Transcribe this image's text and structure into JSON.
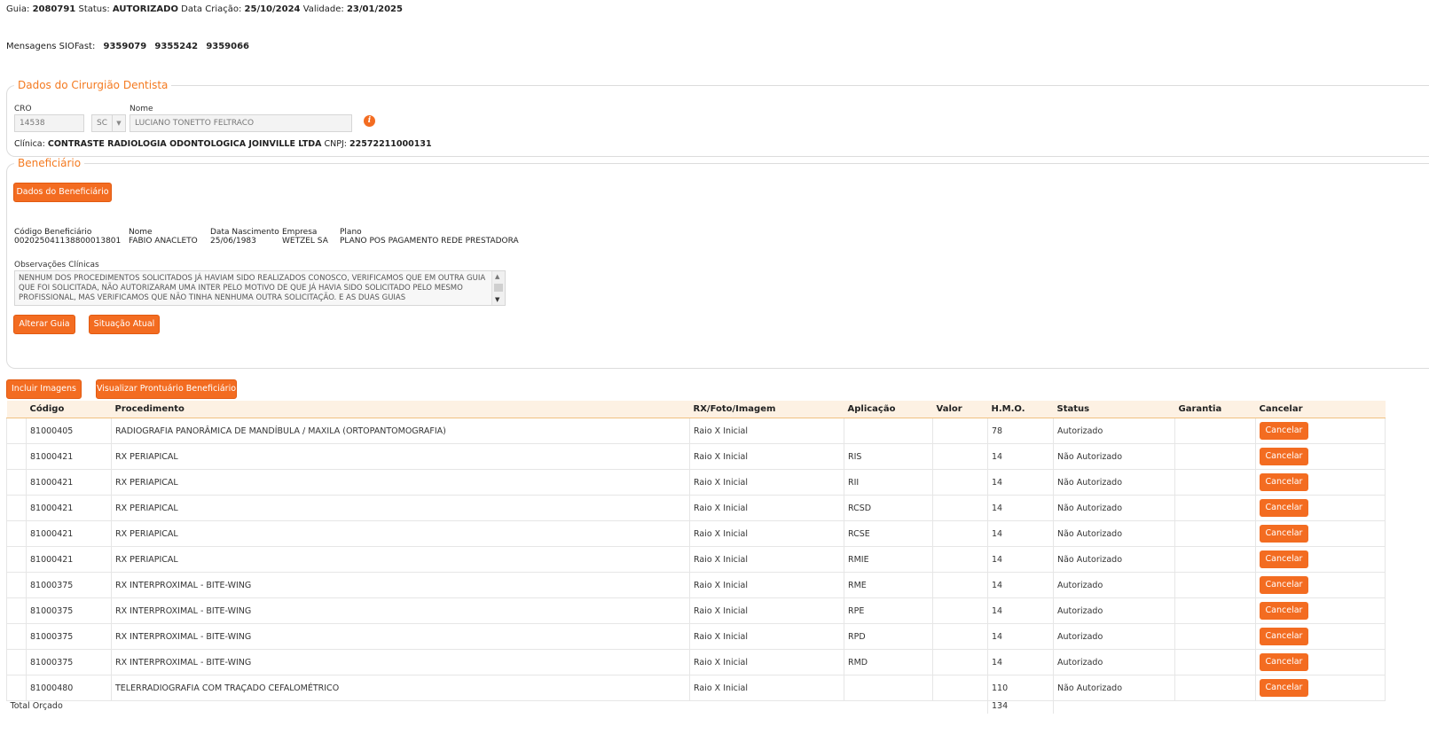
{
  "guia": {
    "guia_label": "Guia:",
    "guia_value": "2080791",
    "status_label": "Status:",
    "status_value": "AUTORIZADO",
    "criacao_label": "Data Criação:",
    "criacao_value": "25/10/2024",
    "validade_label": "Validade:",
    "validade_value": "23/01/2025"
  },
  "mensagens": {
    "label": "Mensagens SIOFast:",
    "values": [
      "9359079",
      "9355242",
      "9359066"
    ]
  },
  "dentista": {
    "legend": "Dados do Cirurgião Dentista",
    "cro_label": "CRO",
    "cro_value": "14538",
    "uf_value": "SC",
    "nome_label": "Nome",
    "nome_value": "LUCIANO TONETTO FELTRACO",
    "clinica_label": "Clínica:",
    "clinica_value": "CONTRASTE RADIOLOGIA ODONTOLOGICA JOINVILLE LTDA",
    "cnpj_label": "CNPJ:",
    "cnpj_value": "22572211000131"
  },
  "beneficiario": {
    "legend": "Beneficiário",
    "dados_button": "Dados do Beneficiário",
    "codigo_label": "Código Beneficiário",
    "codigo_value": "00202504113880001380​1",
    "nome_label": "Nome",
    "nome_value": "FABIO ANACLETO",
    "nasc_label": "Data Nascimento",
    "nasc_value": "25/06/1983",
    "empresa_label": "Empresa",
    "empresa_value": "WETZEL SA",
    "plano_label": "Plano",
    "plano_value": "PLANO POS PAGAMENTO REDE PRESTADORA",
    "obs_label": "Observações Clínicas",
    "obs_text": "NENHUM DOS PROCEDIMENTOS SOLICITADOS JÁ HAVIAM SIDO REALIZADOS CONOSCO, VERIFICAMOS QUE EM OUTRA GUIA QUE FOI SOLICITADA, NÃO AUTORIZARAM UMA INTER PELO MOTIVO DE QUE JÁ HAVIA SIDO SOLICITADO PELO MESMO PROFISSIONAL, MAS VERIFICAMOS QUE NÃO TINHA NENHUMA OUTRA SOLICITAÇÃO. E AS DUAS GUIAS",
    "alterar_button": "Alterar Guia",
    "situacao_button": "Situação Atual"
  },
  "actions": {
    "incluir_imagens": "Incluir Imagens",
    "visualizar_prontuario": "Visualizar Prontuário Beneficiário"
  },
  "table": {
    "headers": [
      "",
      "Código",
      "Procedimento",
      "RX/Foto/Imagem",
      "Aplicação",
      "Valor",
      "H.M.O.",
      "Status",
      "Garantia",
      "Cancelar"
    ],
    "cancel_label": "Cancelar",
    "rows": [
      [
        "81000405",
        "RADIOGRAFIA PANORÂMICA DE MANDÍBULA / MAXILA (ORTOPANTOMOGRAFIA)",
        "Raio X Inicial",
        "",
        "",
        "78",
        "Autorizado",
        ""
      ],
      [
        "81000421",
        "RX PERIAPICAL",
        "Raio X Inicial",
        "RIS",
        "",
        "14",
        "Não Autorizado",
        ""
      ],
      [
        "81000421",
        "RX PERIAPICAL",
        "Raio X Inicial",
        "RII",
        "",
        "14",
        "Não Autorizado",
        ""
      ],
      [
        "81000421",
        "RX PERIAPICAL",
        "Raio X Inicial",
        "RCSD",
        "",
        "14",
        "Não Autorizado",
        ""
      ],
      [
        "81000421",
        "RX PERIAPICAL",
        "Raio X Inicial",
        "RCSE",
        "",
        "14",
        "Não Autorizado",
        ""
      ],
      [
        "81000421",
        "RX PERIAPICAL",
        "Raio X Inicial",
        "RMIE",
        "",
        "14",
        "Não Autorizado",
        ""
      ],
      [
        "81000375",
        "RX INTERPROXIMAL - BITE-WING",
        "Raio X Inicial",
        "RME",
        "",
        "14",
        "Autorizado",
        ""
      ],
      [
        "81000375",
        "RX INTERPROXIMAL - BITE-WING",
        "Raio X Inicial",
        "RPE",
        "",
        "14",
        "Autorizado",
        ""
      ],
      [
        "81000375",
        "RX INTERPROXIMAL - BITE-WING",
        "Raio X Inicial",
        "RPD",
        "",
        "14",
        "Autorizado",
        ""
      ],
      [
        "81000375",
        "RX INTERPROXIMAL - BITE-WING",
        "Raio X Inicial",
        "RMD",
        "",
        "14",
        "Autorizado",
        ""
      ],
      [
        "81000480",
        "TELERRADIOGRAFIA COM TRAÇADO CEFALOMÉTRICO",
        "Raio X Inicial",
        "",
        "",
        "110",
        "Não Autorizado",
        ""
      ]
    ],
    "total_label": "Total Orçado",
    "total_hmo": "134"
  }
}
